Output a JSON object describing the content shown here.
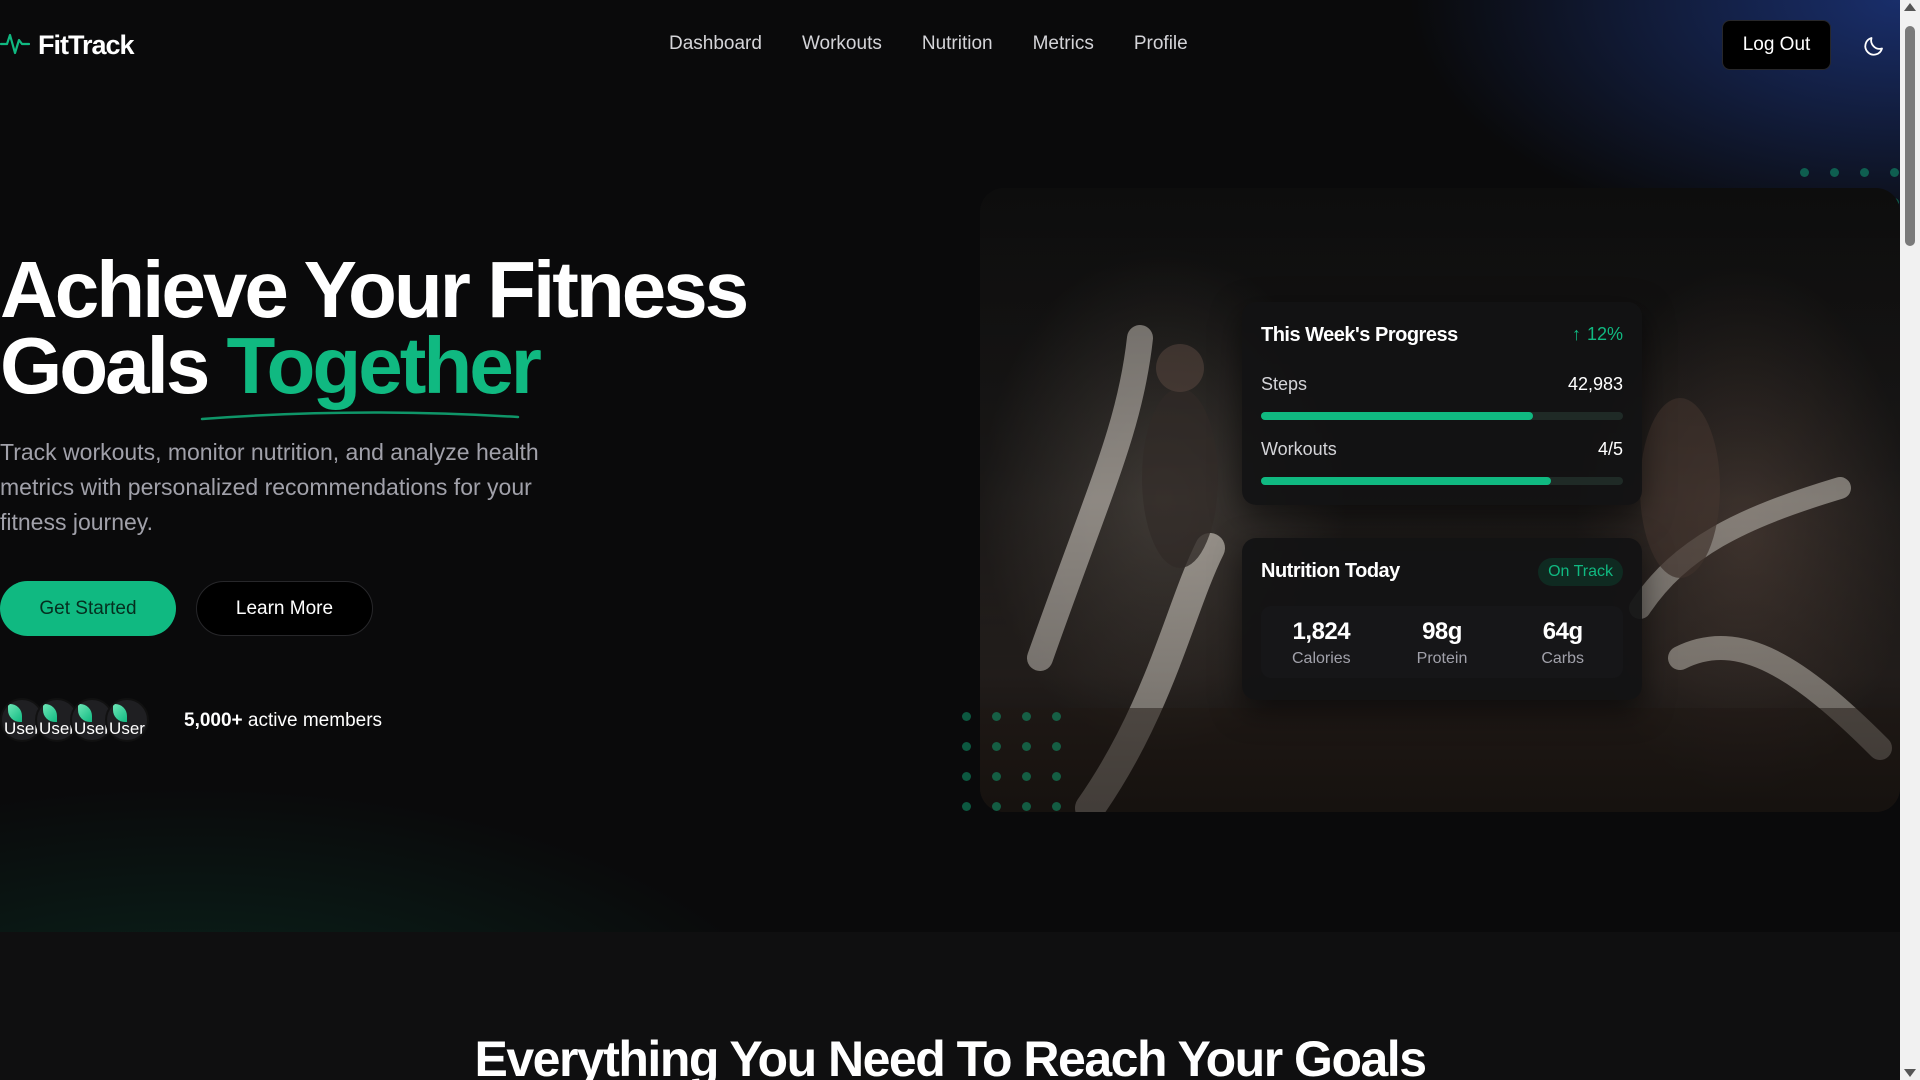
{
  "colors": {
    "accent": "#10b981",
    "background": "#0a0a0b",
    "card": "#121214"
  },
  "header": {
    "brand": "FitTrack",
    "brand_icon": "activity-pulse-icon",
    "nav": [
      {
        "label": "Dashboard"
      },
      {
        "label": "Workouts"
      },
      {
        "label": "Nutrition"
      },
      {
        "label": "Metrics"
      },
      {
        "label": "Profile"
      }
    ],
    "logout_label": "Log Out",
    "theme_icon": "moon-icon"
  },
  "hero": {
    "headline_line1": "Achieve Your Fitness",
    "headline_line2_plain": "Goals ",
    "headline_line2_accent": "Together",
    "subtext": "Track workouts, monitor nutrition, and analyze health metrics with personalized recommendations for your fitness journey.",
    "primary_cta": "Get Started",
    "secondary_cta": "Learn More",
    "avatars": [
      {
        "alt": "User"
      },
      {
        "alt": "User"
      },
      {
        "alt": "User"
      },
      {
        "alt": "User"
      }
    ],
    "members_count": "5,000+",
    "members_suffix": " active members"
  },
  "progress_card": {
    "title": "This Week's Progress",
    "trend_icon": "arrow-up-icon",
    "trend_value": "12%",
    "rows": [
      {
        "label": "Steps",
        "value": "42,983",
        "progress": 0.75
      },
      {
        "label": "Workouts",
        "value": "4/5",
        "progress": 0.8
      }
    ]
  },
  "nutrition_card": {
    "title": "Nutrition Today",
    "status": "On Track",
    "stats": [
      {
        "value": "1,824",
        "label": "Calories"
      },
      {
        "value": "98g",
        "label": "Protein"
      },
      {
        "value": "64g",
        "label": "Carbs"
      }
    ]
  },
  "features": {
    "title": "Everything You Need To Reach Your Goals"
  }
}
